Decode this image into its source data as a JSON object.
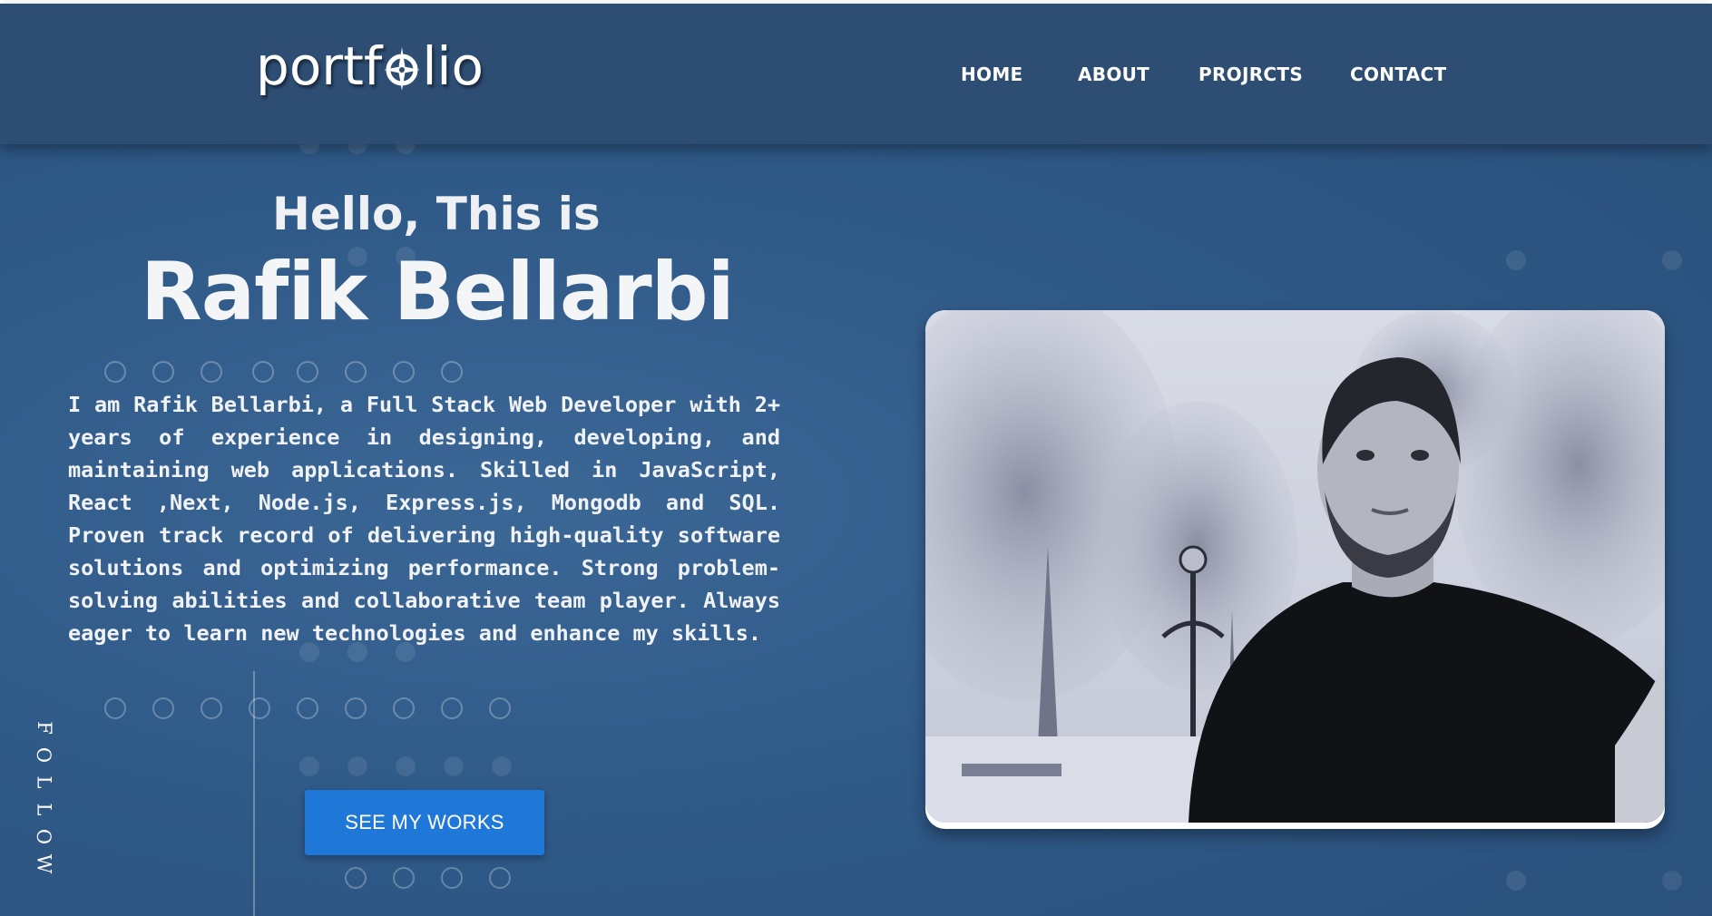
{
  "header": {
    "logo_text_left": "portf",
    "logo_text_right": "lio",
    "nav": {
      "home": "HOME",
      "about": "ABOUT",
      "projects": "PROJRCTS",
      "contact": "CONTACT"
    }
  },
  "hero": {
    "greeting": "Hello, This is",
    "name": "Rafik Bellarbi",
    "bio": "I am Rafik Bellarbi, a Full Stack Web Developer with 2+ years of experience in designing, developing, and maintaining web applications. Skilled in JavaScript, React ,Next, Node.js, Express.js, Mongodb and SQL. Proven track record of delivering high-quality software solutions and optimizing performance. Strong problem-solving abilities and collaborative team player. Always eager to learn new technologies and enhance my skills.",
    "cta_label": "SEE MY WORKS"
  },
  "follow_letters": [
    "F",
    "O",
    "L",
    "L",
    "O",
    "W"
  ],
  "icons": {
    "logo_o": "compass-icon"
  },
  "colors": {
    "background": "#2f5987",
    "header": "#2d4d73",
    "button": "#1f78d8",
    "text": "#ffffff"
  }
}
